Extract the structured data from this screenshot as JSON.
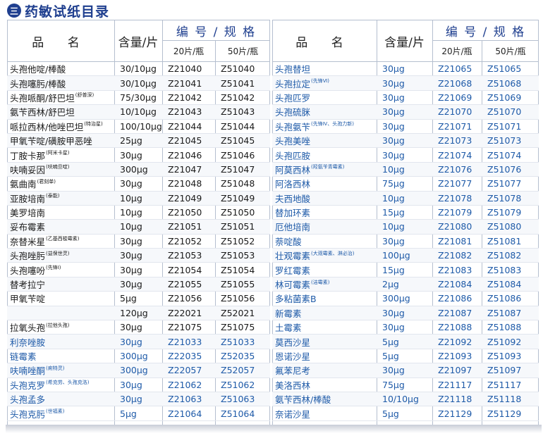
{
  "title": {
    "icon_text": "三",
    "text": "药敏试纸目录"
  },
  "header": {
    "name": "品 名",
    "qty": "含量/片",
    "code_spec": "编 号 / 规 格",
    "sub20": "20片/瓶",
    "sub50": "50片/瓶"
  },
  "colors": {
    "title": "#1f3f8f",
    "blue_text": "#1e5aa8",
    "black_text": "#1a1a1a",
    "grid": "#b5bfcf"
  },
  "left_rows": [
    {
      "name": "头孢他啶/棒酸",
      "note": "",
      "qty": "30/10μg",
      "c20": "Z21040",
      "c50": "Z51040",
      "color": "black"
    },
    {
      "name": "头孢噻肟/棒酸",
      "note": "",
      "qty": "30/10μg",
      "c20": "Z21041",
      "c50": "Z51041",
      "color": "black"
    },
    {
      "name": "头孢哌酮/舒巴坦",
      "note": "(舒普深)",
      "qty": "75/30μg",
      "c20": "Z21042",
      "c50": "Z51042",
      "color": "black"
    },
    {
      "name": "氨苄西林/舒巴坦",
      "note": "",
      "qty": "10/10μg",
      "c20": "Z21043",
      "c50": "Z51043",
      "color": "black"
    },
    {
      "name": "哌拉西林/他唑巴坦",
      "note": "(特治星)",
      "qty": "100/10μg",
      "c20": "Z21044",
      "c50": "Z51044",
      "color": "black"
    },
    {
      "name": "甲氧苄啶/磺胺甲恶唑",
      "note": "",
      "qty": "25μg",
      "c20": "Z21045",
      "c50": "Z51045",
      "color": "black"
    },
    {
      "name": "丁胺卡那",
      "note": "(阿米卡星)",
      "qty": "30μg",
      "c20": "Z21046",
      "c50": "Z51046",
      "color": "black"
    },
    {
      "name": "呋喃妥因",
      "note": "(呋喃旦啶)",
      "qty": "300μg",
      "c20": "Z21047",
      "c50": "Z51047",
      "color": "black"
    },
    {
      "name": "氨曲南",
      "note": "(君刻单)",
      "qty": "30μg",
      "c20": "Z21048",
      "c50": "Z51048",
      "color": "black"
    },
    {
      "name": "亚胺培南",
      "note": "(泰能)",
      "qty": "10μg",
      "c20": "Z21049",
      "c50": "Z51049",
      "color": "black"
    },
    {
      "name": "美罗培南",
      "note": "",
      "qty": "10μg",
      "c20": "Z21050",
      "c50": "Z51050",
      "color": "black"
    },
    {
      "name": "妥布霉素",
      "note": "",
      "qty": "10μg",
      "c20": "Z21051",
      "c50": "Z51051",
      "color": "black"
    },
    {
      "name": "奈替米星",
      "note": "(乙基西梭霉素)",
      "qty": "30μg",
      "c20": "Z21052",
      "c50": "Z51052",
      "color": "black"
    },
    {
      "name": "头孢唑肟",
      "note": "(益保世灵)",
      "qty": "30μg",
      "c20": "Z21053",
      "c50": "Z51053",
      "color": "black"
    },
    {
      "name": "头孢噻吩",
      "note": "(先锋Ⅰ)",
      "qty": "30μg",
      "c20": "Z21054",
      "c50": "Z51054",
      "color": "black"
    },
    {
      "name": "替考拉宁",
      "note": "",
      "qty": "30μg",
      "c20": "Z21055",
      "c50": "Z51055",
      "color": "black"
    },
    {
      "name": "甲氧苄啶",
      "note": "",
      "qty": "5μg",
      "c20": "Z21056",
      "c50": "Z51056",
      "color": "black"
    },
    {
      "name": "",
      "note": "",
      "qty": "120μg",
      "c20": "Z22021",
      "c50": "Z52021",
      "color": "black"
    },
    {
      "name": "拉氧头孢",
      "note": "(拉他头孢)",
      "qty": "30μg",
      "c20": "Z21075",
      "c50": "Z51075",
      "color": "black"
    },
    {
      "name": "利奈唑胺",
      "note": "",
      "qty": "30μg",
      "c20": "Z21033",
      "c50": "Z51033",
      "color": "blue"
    },
    {
      "name": "链霉素",
      "note": "",
      "qty": "300μg",
      "c20": "Z22035",
      "c50": "Z52035",
      "color": "blue"
    },
    {
      "name": "呋喃唑酮",
      "note": "(痢特灵)",
      "qty": "300μg",
      "c20": "Z22057",
      "c50": "Z52057",
      "color": "blue"
    },
    {
      "name": "头孢克罗",
      "note": "(希克劳、头孢克洛)",
      "qty": "30μg",
      "c20": "Z21062",
      "c50": "Z51062",
      "color": "blue"
    },
    {
      "name": "头孢孟多",
      "note": "",
      "qty": "30μg",
      "c20": "Z21063",
      "c50": "Z51063",
      "color": "blue"
    },
    {
      "name": "头孢克肟",
      "note": "(世福素)",
      "qty": "5μg",
      "c20": "Z21064",
      "c50": "Z51064",
      "color": "blue"
    }
  ],
  "right_rows": [
    {
      "name": "头孢替坦",
      "note": "",
      "qty": "30μg",
      "c20": "Z21065",
      "c50": "Z51065",
      "color": "blue"
    },
    {
      "name": "头孢拉定",
      "note": "(先锋Ⅵ)",
      "qty": "30μg",
      "c20": "Z21068",
      "c50": "Z51068",
      "color": "blue"
    },
    {
      "name": "头孢匹罗",
      "note": "",
      "qty": "30μg",
      "c20": "Z21069",
      "c50": "Z51069",
      "color": "blue"
    },
    {
      "name": "头孢硫脒",
      "note": "",
      "qty": "30μg",
      "c20": "Z21070",
      "c50": "Z51070",
      "color": "blue"
    },
    {
      "name": "头孢氨苄",
      "note": "(先锋Ⅳ、头孢力新)",
      "qty": "30μg",
      "c20": "Z21071",
      "c50": "Z51071",
      "color": "blue"
    },
    {
      "name": "头孢美唑",
      "note": "",
      "qty": "30μg",
      "c20": "Z21073",
      "c50": "Z51073",
      "color": "blue"
    },
    {
      "name": "头孢匹胺",
      "note": "",
      "qty": "30μg",
      "c20": "Z21074",
      "c50": "Z51074",
      "color": "blue"
    },
    {
      "name": "阿莫西林",
      "note": "(羟氨苄青霉素)",
      "qty": "10μg",
      "c20": "Z21076",
      "c50": "Z51076",
      "color": "blue"
    },
    {
      "name": "阿洛西林",
      "note": "",
      "qty": "75μg",
      "c20": "Z21077",
      "c50": "Z51077",
      "color": "blue"
    },
    {
      "name": "夫西地酸",
      "note": "",
      "qty": "10μg",
      "c20": "Z21078",
      "c50": "Z51078",
      "color": "blue"
    },
    {
      "name": "替加环素",
      "note": "",
      "qty": "15μg",
      "c20": "Z21079",
      "c50": "Z51079",
      "color": "blue"
    },
    {
      "name": "厄他培南",
      "note": "",
      "qty": "10μg",
      "c20": "Z21080",
      "c50": "Z51080",
      "color": "blue"
    },
    {
      "name": "萘啶酸",
      "note": "",
      "qty": "30μg",
      "c20": "Z21081",
      "c50": "Z51081",
      "color": "blue"
    },
    {
      "name": "壮观霉素",
      "note": "(大观霉素、淋必治)",
      "qty": "100μg",
      "c20": "Z21082",
      "c50": "Z51082",
      "color": "blue"
    },
    {
      "name": "罗红霉素",
      "note": "",
      "qty": "15μg",
      "c20": "Z21083",
      "c50": "Z51083",
      "color": "blue"
    },
    {
      "name": "林可霉素",
      "note": "(洁霉素)",
      "qty": "2μg",
      "c20": "Z21084",
      "c50": "Z51084",
      "color": "blue"
    },
    {
      "name": "多粘菌素B",
      "note": "",
      "qty": "300μg",
      "c20": "Z21086",
      "c50": "Z51086",
      "color": "blue"
    },
    {
      "name": "新霉素",
      "note": "",
      "qty": "30μg",
      "c20": "Z21087",
      "c50": "Z51087",
      "color": "blue"
    },
    {
      "name": "土霉素",
      "note": "",
      "qty": "30μg",
      "c20": "Z21088",
      "c50": "Z51088",
      "color": "blue"
    },
    {
      "name": "莫西沙星",
      "note": "",
      "qty": "5μg",
      "c20": "Z21092",
      "c50": "Z51092",
      "color": "blue"
    },
    {
      "name": "恩诺沙星",
      "note": "",
      "qty": "5μg",
      "c20": "Z21093",
      "c50": "Z51093",
      "color": "blue"
    },
    {
      "name": "氟苯尼考",
      "note": "",
      "qty": "30μg",
      "c20": "Z21097",
      "c50": "Z51097",
      "color": "blue"
    },
    {
      "name": "美洛西林",
      "note": "",
      "qty": "75μg",
      "c20": "Z21117",
      "c50": "Z51117",
      "color": "blue"
    },
    {
      "name": "氨苄西林/棒酸",
      "note": "",
      "qty": "10/10μg",
      "c20": "Z21118",
      "c50": "Z51118",
      "color": "blue"
    },
    {
      "name": "奈诺沙星",
      "note": "",
      "qty": "5μg",
      "c20": "Z21129",
      "c50": "Z51129",
      "color": "blue"
    }
  ]
}
